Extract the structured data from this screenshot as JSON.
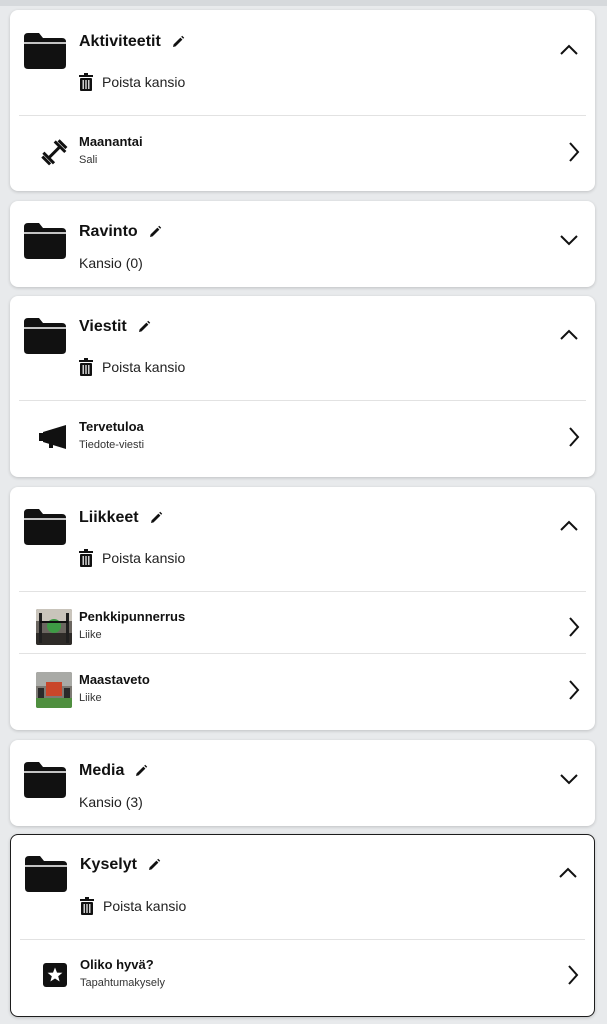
{
  "folders": [
    {
      "title": "Aktiviteetit",
      "expanded": true,
      "delete_label": "Poista kansio",
      "items": [
        {
          "name": "Maanantai",
          "desc": "Sali",
          "icon": "dumbbell-icon"
        }
      ]
    },
    {
      "title": "Ravinto",
      "expanded": false,
      "count_label": "Kansio (0)"
    },
    {
      "title": "Viestit",
      "expanded": true,
      "delete_label": "Poista kansio",
      "items": [
        {
          "name": "Tervetuloa",
          "desc": "Tiedote-viesti",
          "icon": "megaphone-icon"
        }
      ]
    },
    {
      "title": "Liikkeet",
      "expanded": true,
      "delete_label": "Poista kansio",
      "items": [
        {
          "name": "Penkkipunnerrus",
          "desc": "Liike",
          "icon": "exercise-thumbnail"
        },
        {
          "name": "Maastaveto",
          "desc": "Liike",
          "icon": "exercise-thumbnail"
        }
      ]
    },
    {
      "title": "Media",
      "expanded": false,
      "count_label": "Kansio (3)"
    },
    {
      "title": "Kyselyt",
      "expanded": true,
      "selected": true,
      "delete_label": "Poista kansio",
      "items": [
        {
          "name": "Oliko hyvä?",
          "desc": "Tapahtumakysely",
          "icon": "star-icon"
        }
      ]
    }
  ],
  "colors": {
    "background": "#e8eaec",
    "card": "#ffffff",
    "text": "#111111"
  }
}
